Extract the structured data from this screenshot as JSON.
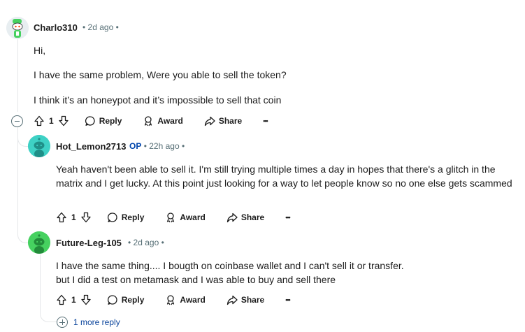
{
  "comments": [
    {
      "author": "Charlo310",
      "age": "2d ago",
      "paragraphs": [
        "Hi,",
        "I have the same problem, Were you able to sell the token?",
        "I think it’s an honeypot and it’s impossible to sell that coin"
      ],
      "votes": "1",
      "reply_label": "Reply",
      "award_label": "Award",
      "share_label": "Share",
      "more_label": "•••"
    },
    {
      "author": "Hot_Lemon2713",
      "op_badge": "OP",
      "age": "22h ago",
      "paragraphs": [
        "Yeah haven't been able to sell it. I'm still trying multiple times a day in hopes that there's a glitch in the matrix and I get lucky. At this point just looking for a way to let people know so no one else gets scammed"
      ],
      "votes": "1",
      "reply_label": "Reply",
      "award_label": "Award",
      "share_label": "Share",
      "more_label": "•••"
    },
    {
      "author": "Future-Leg-105",
      "age": "2d ago",
      "paragraphs": [
        "I have the same thing.... I bougth on coinbase wallet and I can't sell it or transfer.",
        "but I did a test on metamask and I was able to buy and sell there"
      ],
      "votes": "1",
      "reply_label": "Reply",
      "award_label": "Award",
      "share_label": "Share",
      "more_label": "•••"
    }
  ],
  "more_replies": "1 more reply",
  "separator": "•",
  "colors": {
    "avatar_green": "#46d160",
    "avatar_teal": "#3ed1c5",
    "meta_gray": "#576f76",
    "op_blue": "#0045ac",
    "link_blue": "#0a449b"
  },
  "icons": {
    "upvote": "upvote-icon",
    "downvote": "downvote-icon",
    "reply": "comment-icon",
    "award": "award-icon",
    "share": "share-icon",
    "collapse": "minus-circle-icon",
    "more_replies": "plus-circle-icon"
  }
}
